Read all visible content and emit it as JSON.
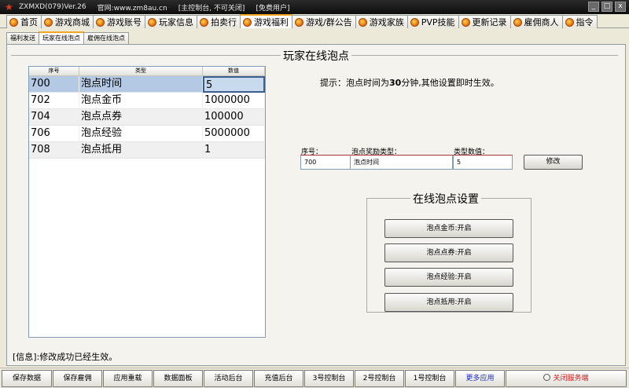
{
  "window": {
    "title_app": "ZXMXD(079)Ver.26",
    "title_site": "官网:www.zm8au.cn",
    "title_status": "[主控制台, 不可关闭]",
    "title_user": "[免费用户]",
    "min": "_",
    "max": "□",
    "close": "x"
  },
  "main_tabs": [
    "首页",
    "游戏商城",
    "游戏账号",
    "玩家信息",
    "拍卖行",
    "游戏福利",
    "游戏/群公告",
    "游戏家族",
    "PVP技能",
    "更新记录",
    "雇佣商人",
    "指令"
  ],
  "main_tab_active": "游戏福利",
  "sub_tabs": [
    "福利发送",
    "玩家在线泡点",
    "雇佣在线泡点"
  ],
  "sub_tab_active": "玩家在线泡点",
  "section_title": "玩家在线泡点",
  "table": {
    "headers": [
      "序号",
      "类型",
      "数值"
    ],
    "rows": [
      {
        "id": "700",
        "type": "泡点时间",
        "value": "5"
      },
      {
        "id": "702",
        "type": "泡点金币",
        "value": "1000000"
      },
      {
        "id": "704",
        "type": "泡点点券",
        "value": "100000"
      },
      {
        "id": "706",
        "type": "泡点经验",
        "value": "5000000"
      },
      {
        "id": "708",
        "type": "泡点抵用",
        "value": "1"
      }
    ]
  },
  "hint": {
    "prefix": "提示：泡点时间为",
    "bold": "30",
    "suffix": "分钟,其他设置即时生效。"
  },
  "edit": {
    "id_label": "序号：",
    "type_label": "泡点奖励类型：",
    "value_label": "类型数值：",
    "id_value": "700",
    "type_value": "泡点时间",
    "value_value": "5",
    "modify_button": "修改"
  },
  "settings": {
    "title": "在线泡点设置",
    "buttons": [
      "泡点金币:开启",
      "泡点点券:开启",
      "泡点经验:开启",
      "泡点抵用:开启"
    ]
  },
  "status_text": "[信息]:修改成功已经生效。",
  "bottom_buttons": [
    "保存数据",
    "保存雇佣",
    "应用重载",
    "数据面板",
    "活动后台",
    "充值后台",
    "3号控制台",
    "2号控制台",
    "1号控制台",
    "更多应用"
  ],
  "close_service": "关闭服务端"
}
